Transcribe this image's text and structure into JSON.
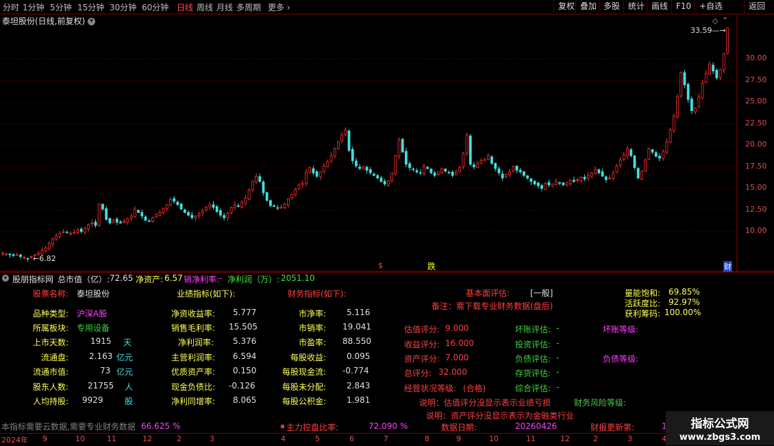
{
  "toolbar": {
    "periods": [
      "分时",
      "1分钟",
      "5分钟",
      "15分钟",
      "30分钟",
      "60分钟",
      "日线",
      "周线",
      "月线",
      "多周期",
      "更多"
    ],
    "active_period": "日线",
    "right_buttons": [
      "复权",
      "叠加",
      "多股",
      "统计",
      "画线",
      "F10",
      "+自选",
      "返回"
    ]
  },
  "chart": {
    "title": "泰坦股份(日线,前复权)",
    "high_label": "33.59",
    "low_label": "6.82",
    "y_ticks": [
      "30.00",
      "27.50",
      "25.00",
      "22.50",
      "20.00",
      "17.50",
      "15.00",
      "12.50",
      "10.00"
    ],
    "markers": {
      "s": "$",
      "d": "跌",
      "c": "财"
    },
    "colors": {
      "up": "#ff3030",
      "down": "#40e0e0",
      "grid": "#7a0000"
    }
  },
  "chart_data": {
    "type": "candlestick",
    "ylim": [
      6.0,
      34.0
    ],
    "y_ticks": [
      10.0,
      12.5,
      15.0,
      17.5,
      20.0,
      22.5,
      25.0,
      27.5,
      30.0
    ],
    "x_ticks": [
      "2024年",
      "9",
      "10",
      "11",
      "12",
      "2",
      "3",
      "4",
      "5",
      "6",
      "7",
      "8",
      "9",
      "10",
      "11",
      "12",
      "2",
      "3",
      "4"
    ],
    "close_path": [
      7.5,
      7.4,
      7.3,
      7.2,
      7.3,
      7.1,
      7.0,
      6.9,
      7.1,
      7.3,
      7.5,
      7.8,
      8.1,
      8.6,
      9.2,
      9.5,
      9.8,
      10.0,
      9.9,
      9.8,
      9.9,
      10.2,
      10.0,
      10.4,
      10.8,
      11.0,
      10.7,
      13.2,
      12.6,
      11.4,
      11.0,
      11.3,
      11.1,
      11.0,
      11.2,
      11.5,
      11.8,
      12.6,
      12.2,
      11.8,
      11.3,
      11.2,
      11.6,
      12.0,
      12.2,
      12.7,
      13.1,
      13.7,
      13.5,
      13.1,
      12.6,
      12.2,
      11.9,
      11.6,
      11.8,
      12.1,
      12.4,
      12.8,
      13.1,
      12.8,
      12.3,
      11.9,
      11.6,
      12.1,
      12.8,
      13.1,
      12.9,
      13.4,
      13.9,
      14.8,
      15.8,
      16.4,
      15.8,
      14.5,
      13.6,
      13.0,
      12.9,
      12.7,
      12.8,
      13.2,
      13.8,
      14.3,
      14.9,
      15.4,
      15.6,
      16.9,
      17.4,
      16.8,
      16.4,
      16.9,
      17.6,
      18.1,
      18.8,
      19.6,
      20.4,
      21.2,
      21.8,
      19.4,
      18.2,
      17.6,
      17.3,
      17.5,
      17.1,
      16.8,
      16.5,
      16.2,
      15.8,
      15.5,
      15.9,
      16.8,
      18.8,
      20.6,
      19.2,
      17.8,
      17.4,
      17.2,
      16.9,
      16.8,
      17.6,
      17.3,
      16.8,
      16.5,
      16.9,
      17.3,
      17.0,
      16.8,
      16.5,
      16.9,
      17.4,
      19.1,
      21.2,
      17.8,
      17.5,
      17.9,
      18.2,
      18.4,
      18.8,
      17.9,
      17.3,
      16.8,
      16.2,
      16.6,
      16.9,
      17.5,
      17.1,
      16.9,
      16.5,
      16.2,
      15.8,
      15.5,
      15.3,
      15.0,
      15.6,
      15.4,
      15.5,
      15.8,
      15.6,
      15.4,
      15.7,
      15.9,
      15.8,
      16.0,
      16.3,
      16.1,
      16.5,
      16.8,
      17.2,
      16.8,
      16.4,
      16.0,
      16.2,
      16.8,
      17.6,
      18.3,
      18.9,
      19.6,
      18.8,
      17.4,
      16.2,
      17.0,
      18.3,
      19.6,
      19.2,
      18.7,
      18.5,
      19.3,
      20.4,
      21.8,
      23.4,
      25.6,
      28.4,
      27.0,
      25.3,
      24.0,
      24.3,
      25.6,
      27.2,
      28.3,
      29.4,
      28.6,
      27.8,
      28.8,
      30.6,
      33.59
    ]
  },
  "panel": {
    "header": {
      "name": "股朋指标网",
      "total_mv_label": "总市值（亿）:",
      "total_mv": "72.65",
      "net_assets_label": "净资产:",
      "net_assets": "6.57",
      "net_margin_label": "销净利率:",
      "net_margin": "-",
      "net_profit_label": "净利润（万）:",
      "net_profit": "2051.10"
    },
    "col1": {
      "title_label": "股票名称:",
      "title_value": "泰坦股份",
      "rows": [
        {
          "label": "品种类型:",
          "value": "沪深A股",
          "unit": ""
        },
        {
          "label": "所属板块:",
          "value": "专用设备",
          "unit": ""
        },
        {
          "label": "上市天数:",
          "value": "1915",
          "unit": "天"
        },
        {
          "label": "流通盘:",
          "value": "2.163",
          "unit": "亿元"
        },
        {
          "label": "流通市值:",
          "value": "73",
          "unit": "亿元"
        },
        {
          "label": "股东人数:",
          "value": "21755",
          "unit": "人"
        },
        {
          "label": "人均持股:",
          "value": "9929",
          "unit": "股"
        }
      ]
    },
    "col2": {
      "title": "业绩指标(如下):",
      "rows": [
        {
          "label": "净资收益率:",
          "value": "5.777"
        },
        {
          "label": "销售毛利率:",
          "value": "15.505"
        },
        {
          "label": "净利润率:",
          "value": "5.376"
        },
        {
          "label": "主营利润率:",
          "value": "6.594"
        },
        {
          "label": "优质资产率:",
          "value": "0.150"
        },
        {
          "label": "现金负债比:",
          "value": "-0.126"
        },
        {
          "label": "净利同增率:",
          "value": "8.065"
        }
      ]
    },
    "col3": {
      "title": "财务指标(如下):",
      "rows": [
        {
          "label": "市净率:",
          "value": "5.116"
        },
        {
          "label": "市销率:",
          "value": "19.041"
        },
        {
          "label": "市盈率:",
          "value": "88.550"
        },
        {
          "label": "每股收益:",
          "value": "0.095"
        },
        {
          "label": "每股现金流:",
          "value": "-0.774"
        },
        {
          "label": "每股未分配:",
          "value": "2.843"
        },
        {
          "label": "每股公积金:",
          "value": "1.981"
        }
      ]
    },
    "fundamental": {
      "label": "基本面评估:",
      "value": "[一般]",
      "note": "备注：需下载专业财务数据(盘后)"
    },
    "scores": [
      {
        "label": "估值评分:",
        "value": "9.000"
      },
      {
        "label": "收益评分:",
        "value": "16.000"
      },
      {
        "label": "资产评分:",
        "value": "7.000"
      },
      {
        "label": "总评分:",
        "value": "32.000"
      },
      {
        "label": "经营状况等级:",
        "value": "(合格)"
      }
    ],
    "evals": [
      {
        "label": "坏账评估:",
        "value": "-"
      },
      {
        "label": "投资评估:",
        "value": "-"
      },
      {
        "label": "负债评估:",
        "value": "-"
      },
      {
        "label": "存货评估:",
        "value": "-"
      },
      {
        "label": "综合评估:",
        "value": "-"
      }
    ],
    "grades": [
      {
        "label": "坏账等级:"
      },
      {
        "label": "负债等级:"
      }
    ],
    "notes": [
      "说明：估值评分没显示表示业绩亏损",
      "说明：资产评分没显示表示为金融类行业"
    ],
    "risk_label": "财务风险等级:",
    "right_stats": [
      {
        "label": "量能饱和:",
        "value": "69.85%"
      },
      {
        "label": "活跃度比:",
        "value": "92.97%"
      },
      {
        "label": "获利筹码:",
        "value": "100.00%"
      }
    ],
    "footer": {
      "notice": "本指标需要云数据,需要专业财务数据",
      "value1": "66.625",
      "pct1": "%",
      "control_label": "主力控盘比率:",
      "control_value": "72.090",
      "control_pct": "%",
      "date_label": "数据日期:",
      "date_value": "20260426",
      "report_label": "财报更新第:",
      "report_value": "1"
    }
  },
  "time_axis": [
    "2024年",
    "9",
    "10",
    "11",
    "12",
    "2",
    "3",
    "4",
    "5",
    "6",
    "7",
    "8",
    "9",
    "10",
    "11",
    "12",
    "2",
    "3",
    "4"
  ],
  "watermark": {
    "title": "指标公式网",
    "url": "www.zbgs3.com"
  }
}
